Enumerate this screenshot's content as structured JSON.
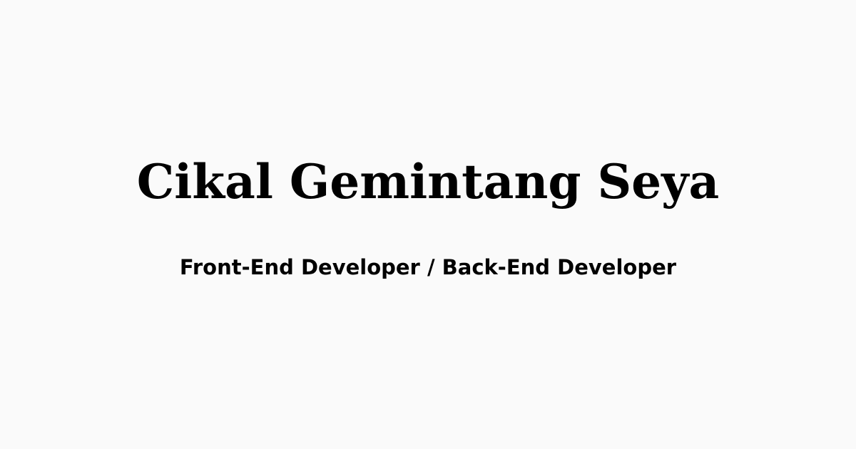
{
  "profile": {
    "name": "Cikal Gemintang Seya",
    "role": "Front-End Developer / Back-End Developer"
  },
  "colors": {
    "background": "#fafafa",
    "text": "#000000"
  }
}
